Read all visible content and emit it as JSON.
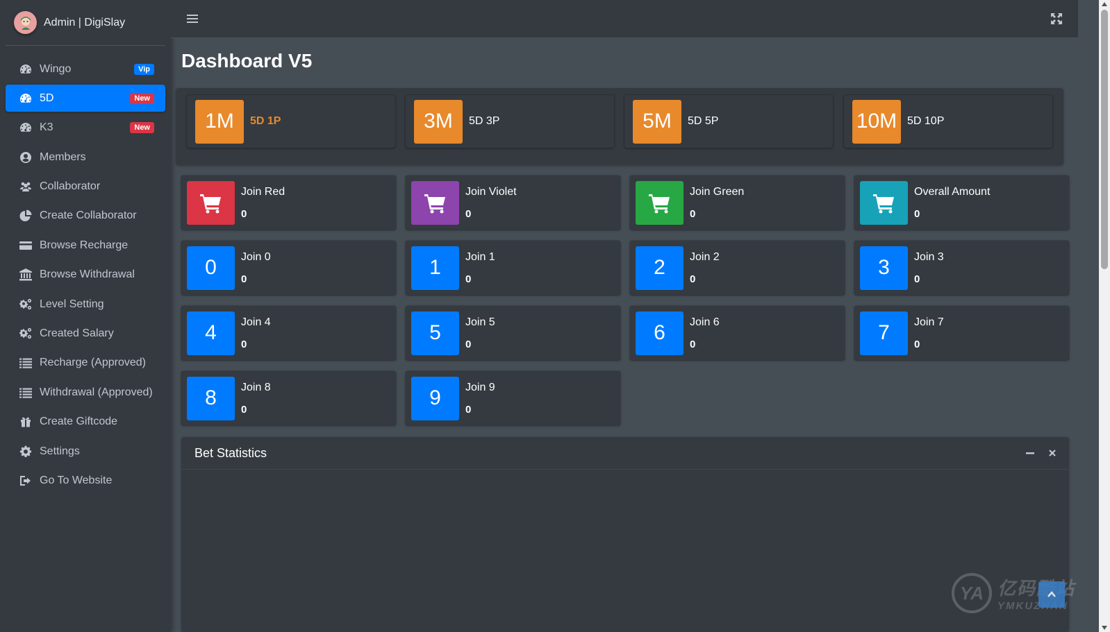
{
  "brand": {
    "title": "Admin | DigiSlay"
  },
  "sidebar": {
    "items": [
      {
        "label": "Wingo",
        "icon": "tachometer-icon",
        "badge": "Vip",
        "badge_type": "vip",
        "active": false
      },
      {
        "label": "5D",
        "icon": "tachometer-icon",
        "badge": "New",
        "badge_type": "new",
        "active": true
      },
      {
        "label": "K3",
        "icon": "tachometer-icon",
        "badge": "New",
        "badge_type": "new",
        "active": false
      },
      {
        "label": "Members",
        "icon": "user-circle-icon",
        "badge": "",
        "active": false
      },
      {
        "label": "Collaborator",
        "icon": "users-icon",
        "badge": "",
        "active": false
      },
      {
        "label": "Create Collaborator",
        "icon": "pie-chart-icon",
        "badge": "",
        "active": false
      },
      {
        "label": "Browse Recharge",
        "icon": "credit-card-icon",
        "badge": "",
        "active": false
      },
      {
        "label": "Browse Withdrawal",
        "icon": "bank-icon",
        "badge": "",
        "active": false
      },
      {
        "label": "Level Setting",
        "icon": "cogs-icon",
        "badge": "",
        "active": false
      },
      {
        "label": "Created Salary",
        "icon": "cogs-icon",
        "badge": "",
        "active": false
      },
      {
        "label": "Recharge (Approved)",
        "icon": "list-icon",
        "badge": "",
        "active": false
      },
      {
        "label": "Withdrawal (Approved)",
        "icon": "list-icon",
        "badge": "",
        "active": false
      },
      {
        "label": "Create Giftcode",
        "icon": "gift-icon",
        "badge": "",
        "active": false
      },
      {
        "label": "Settings",
        "icon": "gear-icon",
        "badge": "",
        "active": false
      },
      {
        "label": "Go To Website",
        "icon": "sign-out-icon",
        "badge": "",
        "active": false
      }
    ]
  },
  "page": {
    "title": "Dashboard V5"
  },
  "periods": [
    {
      "icon_text": "1M",
      "label": "5D 1P",
      "active": true
    },
    {
      "icon_text": "3M",
      "label": "5D 3P",
      "active": false
    },
    {
      "icon_text": "5M",
      "label": "5D 5P",
      "active": false
    },
    {
      "icon_text": "10M",
      "label": "5D 10P",
      "active": false
    }
  ],
  "color_boxes": [
    {
      "label": "Join Red",
      "value": "0",
      "color": "#dc3545",
      "icon": "cart-icon"
    },
    {
      "label": "Join Violet",
      "value": "0",
      "color": "#8e44ad",
      "icon": "cart-icon"
    },
    {
      "label": "Join Green",
      "value": "0",
      "color": "#28a745",
      "icon": "cart-icon"
    },
    {
      "label": "Overall Amount",
      "value": "0",
      "color": "#17a2b8",
      "icon": "cart-icon"
    }
  ],
  "number_boxes": [
    {
      "digit": "0",
      "label": "Join 0",
      "value": "0"
    },
    {
      "digit": "1",
      "label": "Join 1",
      "value": "0"
    },
    {
      "digit": "2",
      "label": "Join 2",
      "value": "0"
    },
    {
      "digit": "3",
      "label": "Join 3",
      "value": "0"
    },
    {
      "digit": "4",
      "label": "Join 4",
      "value": "0"
    },
    {
      "digit": "5",
      "label": "Join 5",
      "value": "0"
    },
    {
      "digit": "6",
      "label": "Join 6",
      "value": "0"
    },
    {
      "digit": "7",
      "label": "Join 7",
      "value": "0"
    },
    {
      "digit": "8",
      "label": "Join 8",
      "value": "0"
    },
    {
      "digit": "9",
      "label": "Join 9",
      "value": "0"
    }
  ],
  "number_box_color": "#007bff",
  "period_color": "#e8892b",
  "stats": {
    "title": "Bet Statistics"
  },
  "watermark": {
    "cn": "亿码酷站",
    "en": "YMKUZHAN",
    "logo": "YA"
  }
}
